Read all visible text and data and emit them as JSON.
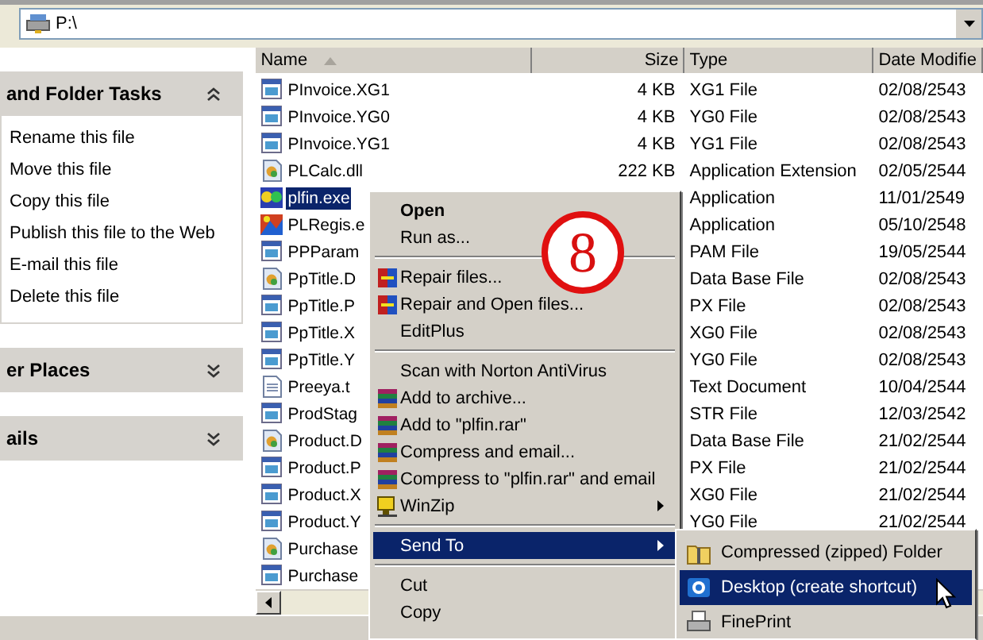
{
  "address_bar": {
    "value": "P:\\"
  },
  "task_panes": [
    {
      "title": "and Folder Tasks",
      "expanded": true,
      "items": [
        "Rename this file",
        "Move this file",
        "Copy this file",
        "Publish this file to the Web",
        "E-mail this file",
        "Delete this file"
      ]
    },
    {
      "title": "er Places",
      "expanded": false
    },
    {
      "title": "ails",
      "expanded": false
    }
  ],
  "file_list": {
    "columns": [
      {
        "label": "Name",
        "sorted": true
      },
      {
        "label": "Size",
        "sorted": false
      },
      {
        "label": "Type",
        "sorted": false
      },
      {
        "label": "Date Modifie",
        "sorted": false
      }
    ],
    "rows": [
      {
        "kind": "doc",
        "name": "PInvoice.XG1",
        "size": "4 KB",
        "type": "XG1 File",
        "date": "02/08/2543",
        "selected": false
      },
      {
        "kind": "doc",
        "name": "PInvoice.YG0",
        "size": "4 KB",
        "type": "YG0 File",
        "date": "02/08/2543",
        "selected": false
      },
      {
        "kind": "doc",
        "name": "PInvoice.YG1",
        "size": "4 KB",
        "type": "YG1 File",
        "date": "02/08/2543",
        "selected": false
      },
      {
        "kind": "dll",
        "name": "PLCalc.dll",
        "size": "222 KB",
        "type": "Application Extension",
        "date": "02/05/2544",
        "selected": false
      },
      {
        "kind": "exe",
        "name": "plfin.exe",
        "type": "Application",
        "date": "11/01/2549",
        "selected": true
      },
      {
        "kind": "exe2",
        "name": "PLRegis.e",
        "type": "Application",
        "date": "05/10/2548",
        "selected": false
      },
      {
        "kind": "doc",
        "name": "PPParam",
        "type": "PAM File",
        "date": "19/05/2544",
        "selected": false
      },
      {
        "kind": "dll",
        "name": "PpTitle.D",
        "type": "Data Base File",
        "date": "02/08/2543",
        "selected": false
      },
      {
        "kind": "doc",
        "name": "PpTitle.P",
        "type": "PX File",
        "date": "02/08/2543",
        "selected": false
      },
      {
        "kind": "doc",
        "name": "PpTitle.X",
        "type": "XG0 File",
        "date": "02/08/2543",
        "selected": false
      },
      {
        "kind": "doc",
        "name": "PpTitle.Y",
        "type": "YG0 File",
        "date": "02/08/2543",
        "selected": false
      },
      {
        "kind": "txt",
        "name": "Preeya.t",
        "type": "Text Document",
        "date": "10/04/2544",
        "selected": false
      },
      {
        "kind": "doc",
        "name": "ProdStag",
        "type": "STR File",
        "date": "12/03/2542",
        "selected": false
      },
      {
        "kind": "dll",
        "name": "Product.D",
        "type": "Data Base File",
        "date": "21/02/2544",
        "selected": false
      },
      {
        "kind": "doc",
        "name": "Product.P",
        "type": "PX File",
        "date": "21/02/2544",
        "selected": false
      },
      {
        "kind": "doc",
        "name": "Product.X",
        "type": "XG0 File",
        "date": "21/02/2544",
        "selected": false
      },
      {
        "kind": "doc",
        "name": "Product.Y",
        "type": "YG0 File",
        "date": "21/02/2544",
        "selected": false
      },
      {
        "kind": "dll",
        "name": "Purchase",
        "selected": false
      },
      {
        "kind": "doc",
        "name": "Purchase",
        "selected": false
      }
    ]
  },
  "context_menu": {
    "items": [
      {
        "kind": "item",
        "label": "Open",
        "default": true,
        "selected": false,
        "submenu": false
      },
      {
        "kind": "item",
        "label": "Run as...",
        "default": false,
        "selected": false,
        "submenu": false
      },
      {
        "kind": "separator"
      },
      {
        "kind": "repair",
        "label": "Repair files...",
        "default": false,
        "selected": false,
        "submenu": false
      },
      {
        "kind": "repair",
        "label": "Repair and Open files...",
        "default": false,
        "selected": false,
        "submenu": false
      },
      {
        "kind": "item",
        "label": "EditPlus",
        "default": false,
        "selected": false,
        "submenu": false
      },
      {
        "kind": "separator"
      },
      {
        "kind": "item",
        "label": "Scan with Norton AntiVirus",
        "default": false,
        "selected": false,
        "submenu": false
      },
      {
        "kind": "archive",
        "label": "Add to archive...",
        "default": false,
        "selected": false,
        "submenu": false
      },
      {
        "kind": "archive",
        "label": "Add to \"plfin.rar\"",
        "default": false,
        "selected": false,
        "submenu": false
      },
      {
        "kind": "archive",
        "label": "Compress and email...",
        "default": false,
        "selected": false,
        "submenu": false
      },
      {
        "kind": "archive",
        "label": "Compress to \"plfin.rar\" and email",
        "default": false,
        "selected": false,
        "submenu": false
      },
      {
        "kind": "winzip",
        "label": "WinZip",
        "default": false,
        "selected": false,
        "submenu": true
      },
      {
        "kind": "separator"
      },
      {
        "kind": "item",
        "label": "Send To",
        "default": false,
        "selected": true,
        "submenu": true
      },
      {
        "kind": "separator"
      },
      {
        "kind": "item",
        "label": "Cut",
        "default": false,
        "selected": false,
        "submenu": false
      },
      {
        "kind": "item",
        "label": "Copy",
        "default": false,
        "selected": false,
        "submenu": false
      }
    ]
  },
  "send_to_menu": {
    "items": [
      {
        "kind": "folder",
        "label": "Compressed (zipped) Folder",
        "selected": false
      },
      {
        "kind": "desktop",
        "label": "Desktop (create shortcut)",
        "selected": true
      },
      {
        "kind": "printer",
        "label": "FinePrint",
        "selected": false
      }
    ]
  },
  "annotation": {
    "label": "8"
  }
}
